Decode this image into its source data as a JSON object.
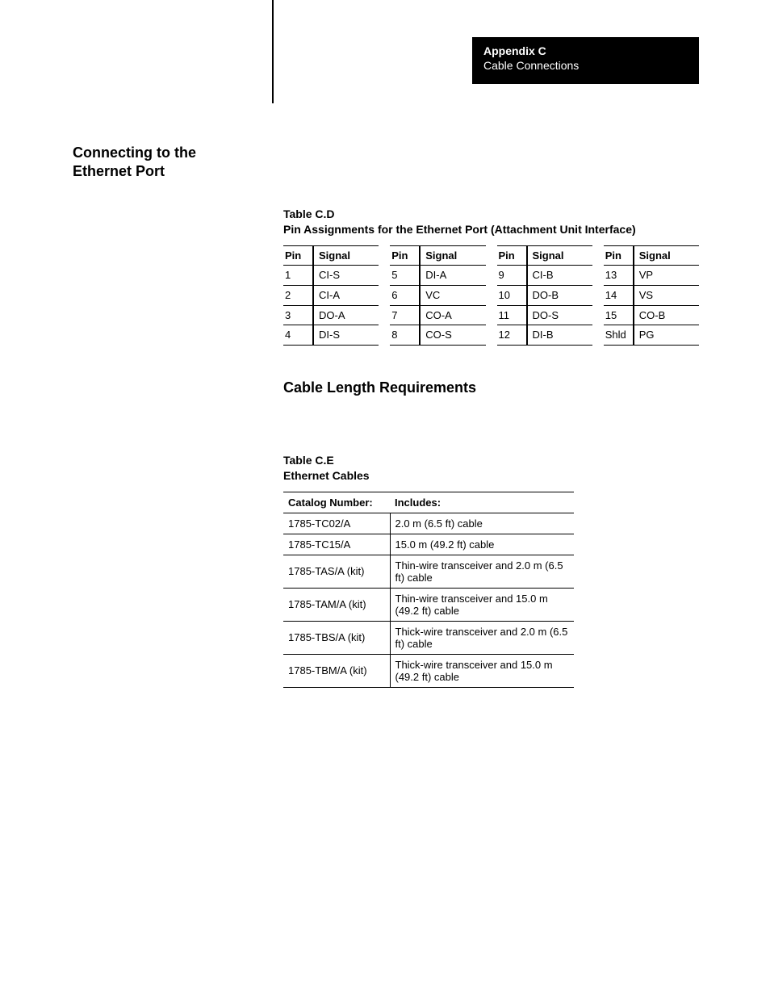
{
  "header": {
    "appendix": "Appendix C",
    "subtitle": "Cable Connections"
  },
  "section_heading": "Connecting to the Ethernet Port",
  "table_d": {
    "label_line1": "Table C.D",
    "label_line2": "Pin Assignments for the Ethernet Port (Attachment Unit Interface)",
    "headers": {
      "pin": "Pin",
      "signal": "Signal"
    },
    "groups": [
      [
        {
          "pin": "1",
          "signal": "CI-S"
        },
        {
          "pin": "2",
          "signal": "CI-A"
        },
        {
          "pin": "3",
          "signal": "DO-A"
        },
        {
          "pin": "4",
          "signal": "DI-S"
        }
      ],
      [
        {
          "pin": "5",
          "signal": "DI-A"
        },
        {
          "pin": "6",
          "signal": "VC"
        },
        {
          "pin": "7",
          "signal": "CO-A"
        },
        {
          "pin": "8",
          "signal": "CO-S"
        }
      ],
      [
        {
          "pin": "9",
          "signal": "CI-B"
        },
        {
          "pin": "10",
          "signal": "DO-B"
        },
        {
          "pin": "11",
          "signal": "DO-S"
        },
        {
          "pin": "12",
          "signal": "DI-B"
        }
      ],
      [
        {
          "pin": "13",
          "signal": "VP"
        },
        {
          "pin": "14",
          "signal": "VS"
        },
        {
          "pin": "15",
          "signal": "CO-B"
        },
        {
          "pin": "Shld",
          "signal": "PG"
        }
      ]
    ]
  },
  "subheading": "Cable Length Requirements",
  "table_e": {
    "label_line1": "Table C.E",
    "label_line2": "Ethernet Cables",
    "headers": {
      "catalog": "Catalog Number:",
      "includes": "Includes:"
    },
    "rows": [
      {
        "catalog": "1785-TC02/A",
        "includes": "2.0 m (6.5 ft) cable"
      },
      {
        "catalog": "1785-TC15/A",
        "includes": "15.0 m (49.2 ft) cable"
      },
      {
        "catalog": "1785-TAS/A (kit)",
        "includes": "Thin-wire transceiver and 2.0 m (6.5 ft) cable"
      },
      {
        "catalog": "1785-TAM/A (kit)",
        "includes": "Thin-wire transceiver and 15.0 m (49.2 ft) cable"
      },
      {
        "catalog": "1785-TBS/A (kit)",
        "includes": "Thick-wire transceiver and 2.0 m (6.5 ft) cable"
      },
      {
        "catalog": "1785-TBM/A (kit)",
        "includes": "Thick-wire transceiver and 15.0 m (49.2 ft) cable"
      }
    ]
  }
}
